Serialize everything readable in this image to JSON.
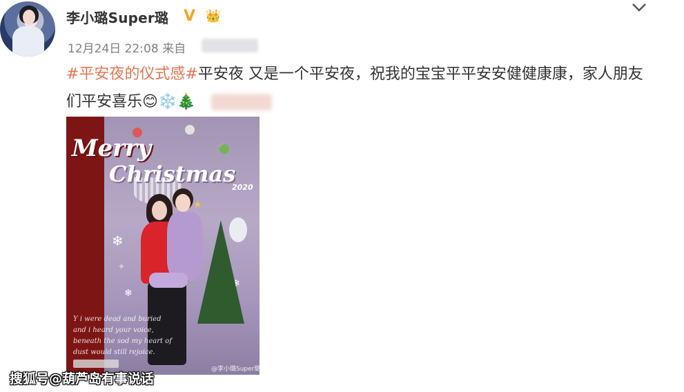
{
  "post": {
    "username": "李小璐Super璐",
    "verified_badge": "V",
    "crown_badge": "👑",
    "timestamp": "12月24日 22:08",
    "source_prefix": "来自",
    "hashtag": "#平安夜的仪式感#",
    "text": "平安夜 又是一个平安夜，祝我的宝宝平平安安健健康康，家人朋友们平安喜乐",
    "emojis": [
      "😊",
      "❄️",
      "🎄"
    ]
  },
  "photo": {
    "title_line1": "Merry",
    "title_line2": "Christmas",
    "year": "2020",
    "scribble_lines": [
      "Y i were dead and buried",
      "and i heard your voice,",
      "beneath the sod my heart of",
      "dust would still rejoice."
    ],
    "watermark": "@李小璐Super璐"
  },
  "site_watermark": "搜狐号@葫芦岛有事说话",
  "icons": {
    "menu": "chevron-down-icon"
  },
  "colors": {
    "hashtag": "#eb7350",
    "timestamp": "#808080",
    "text": "#333333",
    "verified": "#f5a623"
  }
}
